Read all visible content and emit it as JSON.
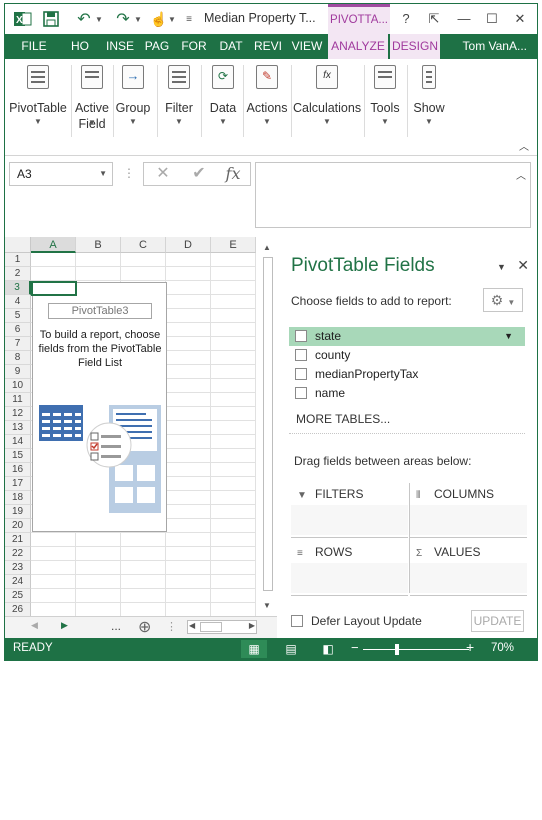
{
  "window": {
    "title": "Median Property T...",
    "context_tab": "PIVOTTA...",
    "qat": {
      "save_icon": "save-icon",
      "undo_icon": "undo-icon",
      "redo_icon": "redo-icon",
      "touch_icon": "touch-mode-icon",
      "customize_icon": "customize-qat-icon"
    },
    "controls": {
      "help": "?",
      "restore_ribbon": "⇱",
      "minimize": "—",
      "maximize": "☐",
      "close": "✕"
    }
  },
  "ribbon_tabs": [
    "FILE",
    "HO",
    "INSE",
    "PAG",
    "FOR",
    "DAT",
    "REVI",
    "VIEW",
    "ANALYZE",
    "DESIGN"
  ],
  "user": "Tom VanA...",
  "ribbon_groups": [
    {
      "label": "PivotTable",
      "label2": ""
    },
    {
      "label": "Active",
      "label2": "Field"
    },
    {
      "label": "Group",
      "label2": ""
    },
    {
      "label": "Filter",
      "label2": ""
    },
    {
      "label": "Data",
      "label2": ""
    },
    {
      "label": "Actions",
      "label2": ""
    },
    {
      "label": "Calculations",
      "label2": ""
    },
    {
      "label": "Tools",
      "label2": ""
    },
    {
      "label": "Show",
      "label2": ""
    }
  ],
  "formula_bar": {
    "name_box": "A3",
    "dots": "⋮",
    "cancel": "✕",
    "enter": "✔",
    "fx": "fx",
    "value": ""
  },
  "grid": {
    "columns": [
      "A",
      "B",
      "C",
      "D",
      "E"
    ],
    "rows": [
      "1",
      "2",
      "3",
      "4",
      "5",
      "6",
      "7",
      "8",
      "9",
      "10",
      "11",
      "12",
      "13",
      "14",
      "15",
      "16",
      "17",
      "18",
      "19",
      "20",
      "21",
      "22",
      "23",
      "24",
      "25",
      "26"
    ],
    "selected_cell": "A3",
    "pivot_placeholder_title": "PivotTable3",
    "pivot_placeholder_text": "To build a report, choose fields from the PivotTable Field List"
  },
  "sheet_bar": {
    "ellipsis": "...",
    "add": "⊕"
  },
  "pane": {
    "title": "PivotTable Fields",
    "choose_label": "Choose fields to add to report:",
    "fields": [
      {
        "name": "state",
        "checked": false,
        "highlighted": true
      },
      {
        "name": "county",
        "checked": false,
        "highlighted": false
      },
      {
        "name": "medianPropertyTax",
        "checked": false,
        "highlighted": false
      },
      {
        "name": "name",
        "checked": false,
        "highlighted": false
      }
    ],
    "more_tables": "MORE TABLES...",
    "drag_label": "Drag fields between areas below:",
    "areas": {
      "filters": "FILTERS",
      "columns": "COLUMNS",
      "rows": "ROWS",
      "values": "VALUES"
    },
    "defer_label": "Defer Layout Update",
    "update_button": "UPDATE"
  },
  "status": {
    "ready": "READY",
    "zoom": "70%",
    "minus": "−",
    "plus": "+"
  },
  "colors": {
    "excel_green": "#217346",
    "ribbon_tab_bg": "#1e7145",
    "pivot_context": "#a03a9d",
    "field_highlight": "#a8d8b9"
  }
}
